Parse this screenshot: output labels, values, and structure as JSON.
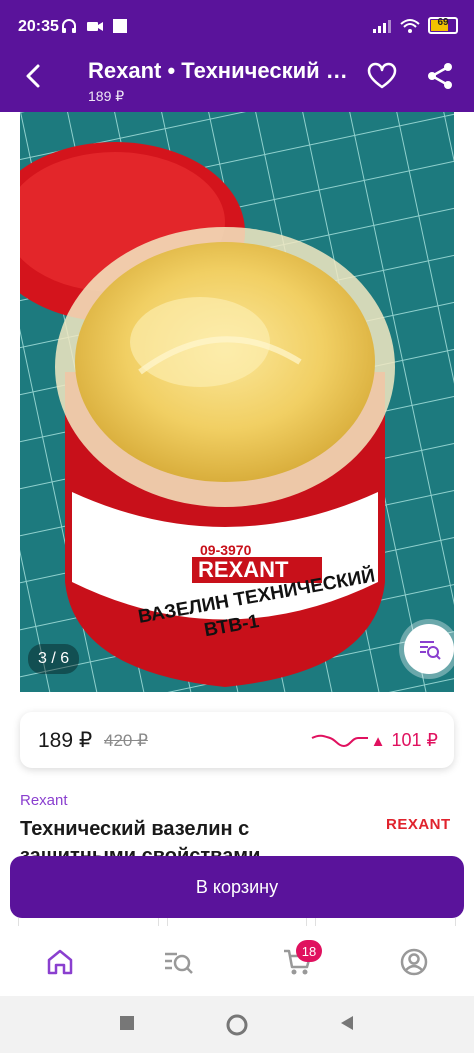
{
  "status_bar": {
    "time": "20:35",
    "battery": "69",
    "icons": [
      "headphones-icon",
      "video-camera-icon",
      "square-icon",
      "signal-icon",
      "wifi-icon",
      "battery-icon"
    ]
  },
  "app_bar": {
    "title": "Rexant • Технический вазелин",
    "subtitle": "189 ₽"
  },
  "gallery": {
    "counter": "3 / 6",
    "image": "jar-of-technical-vaseline-photo"
  },
  "price_card": {
    "price": "189 ₽",
    "old_price": "420 ₽",
    "drop": "101 ₽",
    "drop_color": "#e0115f"
  },
  "product": {
    "brand": "Rexant",
    "brand_logo": "REXANT",
    "title": "Технический вазелин с защитными свойствами"
  },
  "cart_button": {
    "label": "В корзину"
  },
  "tab_bar": {
    "cart_badge": "18",
    "active_tab": "home"
  },
  "colors": {
    "accent": "#5a139b",
    "brand_link": "#8a3fcf",
    "logo_red": "#e0232d"
  }
}
